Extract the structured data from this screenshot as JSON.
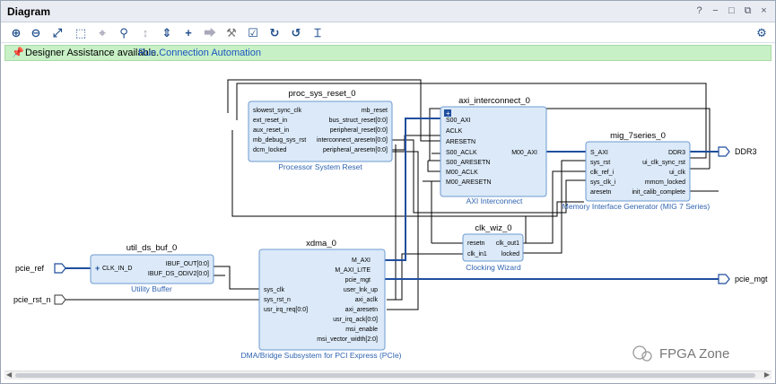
{
  "window": {
    "title": "Diagram",
    "controls": [
      "?",
      "−",
      "□",
      "⧉",
      "×"
    ]
  },
  "toolbar": {
    "icons": [
      "zoom-in-icon",
      "zoom-out-icon",
      "fit-icon",
      "zoom-area-icon",
      "autofit-icon",
      "search-icon",
      "collapse-icon",
      "expand-icon",
      "add-ip-icon",
      "add-module-icon",
      "properties-icon",
      "validate-icon",
      "refresh-icon",
      "regenerate-icon",
      "layout-icon",
      "settings-icon"
    ]
  },
  "banner": {
    "message": "Designer Assistance available.",
    "link": "Run Connection Automation"
  },
  "blocks": {
    "proc_sys_reset": {
      "name": "proc_sys_reset_0",
      "subtitle": "Processor System Reset",
      "left_ports": [
        "slowest_sync_clk",
        "ext_reset_in",
        "aux_reset_in",
        "mb_debug_sys_rst",
        "dcm_locked"
      ],
      "right_ports": [
        "mb_reset",
        "bus_struct_reset[0:0]",
        "peripheral_reset[0:0]",
        "interconnect_aresetn[0:0]",
        "peripheral_aresetn[0:0]"
      ]
    },
    "axi_interconnect": {
      "name": "axi_interconnect_0",
      "subtitle": "AXI Interconnect",
      "left_ports": [
        "S00_AXI",
        "ACLK",
        "ARESETN",
        "S00_ACLK",
        "S00_ARESETN",
        "M00_ACLK",
        "M00_ARESETN"
      ],
      "right_ports": [
        "M00_AXI"
      ]
    },
    "mig": {
      "name": "mig_7series_0",
      "subtitle": "Memory Interface Generator (MIG 7 Series)",
      "left_ports": [
        "S_AXI",
        "sys_rst",
        "clk_ref_i",
        "sys_clk_i",
        "aresetn"
      ],
      "right_ports": [
        "DDR3",
        "ui_clk_sync_rst",
        "ui_clk",
        "mmcm_locked",
        "init_calib_complete"
      ]
    },
    "clk_wiz": {
      "name": "clk_wiz_0",
      "subtitle": "Clocking Wizard",
      "left_ports": [
        "resetn",
        "clk_in1"
      ],
      "right_ports": [
        "clk_out1",
        "locked"
      ]
    },
    "util_ds_buf": {
      "name": "util_ds_buf_0",
      "subtitle": "Utility Buffer",
      "left_ports": [
        "CLK_IN_D"
      ],
      "right_ports": [
        "IBUF_OUT[0:0]",
        "IBUF_DS_ODIV2[0:0]"
      ]
    },
    "xdma": {
      "name": "xdma_0",
      "subtitle": "DMA/Bridge Subsystem for PCI Express (PCIe)",
      "left_ports": [
        "sys_clk",
        "sys_rst_n",
        "usr_irq_req[0:0]"
      ],
      "right_ports": [
        "M_AXI",
        "M_AXI_LITE",
        "pcie_mgt",
        "user_lnk_up",
        "axi_aclk",
        "axi_aresetn",
        "usr_irq_ack[0:0]",
        "msi_enable",
        "msi_vector_width[2:0]"
      ]
    }
  },
  "external_ports": {
    "ddr3": "DDR3",
    "pcie_ref": "pcie_ref",
    "pcie_rst_n": "pcie_rst_n",
    "pcie_mgt": "pcie_mgt"
  },
  "watermark": "FPGA Zone",
  "colors": {
    "block_fill": "#dbe9f8",
    "block_border": "#6d9bd1",
    "net": "#000000",
    "bus": "#1f4e9e",
    "banner": "#c8f0c6"
  }
}
